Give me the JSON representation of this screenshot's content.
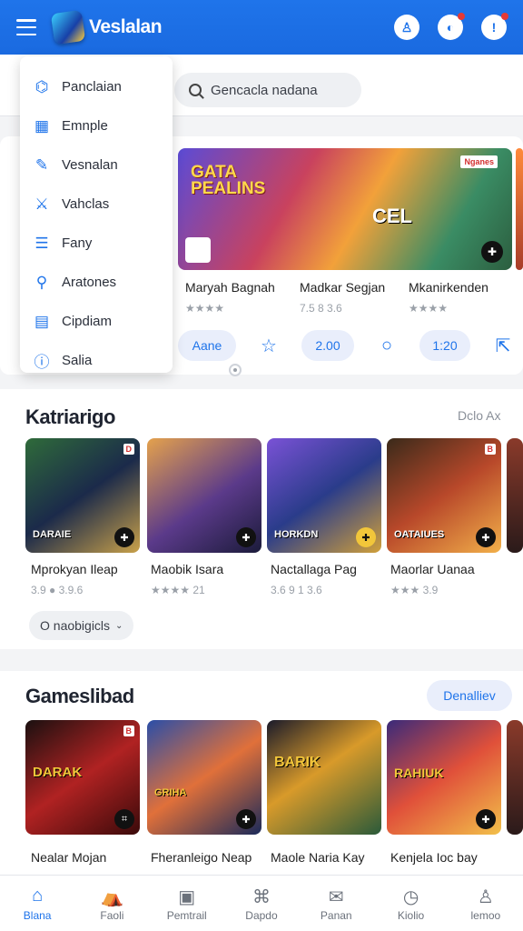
{
  "app": {
    "title": "Veslalan"
  },
  "header": {
    "actions": [
      {
        "icon": "profile-icon",
        "glyph": "♙"
      },
      {
        "icon": "notification-icon",
        "glyph": "◐"
      },
      {
        "icon": "alert-icon",
        "glyph": "!"
      }
    ]
  },
  "search": {
    "placeholder": "Gencacla nadana"
  },
  "drawer": {
    "items": [
      {
        "label": "Panclaian",
        "icon": "compass-icon",
        "glyph": "⌬"
      },
      {
        "label": "Emnple",
        "icon": "grid-icon",
        "glyph": "▦"
      },
      {
        "label": "Vesnalan",
        "icon": "pen-icon",
        "glyph": "✎"
      },
      {
        "label": "Vahclas",
        "icon": "swords-icon",
        "glyph": "⚔"
      },
      {
        "label": "Fany",
        "icon": "list-icon",
        "glyph": "☰"
      },
      {
        "label": "Aratones",
        "icon": "pin-icon",
        "glyph": "⚲"
      },
      {
        "label": "Cipdiam",
        "icon": "calendar-icon",
        "glyph": "▤"
      },
      {
        "label": "Salia",
        "icon": "info-icon",
        "glyph": "ⓘ"
      }
    ]
  },
  "featured": {
    "badge": "Nganes",
    "overlay_line1": "GATA",
    "overlay_line2": "PEALINS",
    "overlay_tag": "CEL",
    "games": [
      {
        "title": "Maryah Bagnah",
        "rating": "★★★★"
      },
      {
        "title": "Madkar Segjan",
        "rating": "7.5 8  3.6"
      },
      {
        "title": "Mkanirkenden",
        "rating": "★★★★"
      }
    ],
    "actions": {
      "primary": "Aane",
      "score1": "2.00",
      "score2": "1:20"
    }
  },
  "section_kategori": {
    "title": "Katriarigo",
    "link": "Dclo Ax",
    "chip": "O naobigicls",
    "games": [
      {
        "title": "Mprokyan Ileap",
        "rating": "3.9  ●  3.9.6",
        "tile_label": "DARAIE",
        "flag": "D"
      },
      {
        "title": "Maobik Isara",
        "rating": "★★★★  21",
        "tile_label": "",
        "flag": ""
      },
      {
        "title": "Nactallaga Pag",
        "rating": "3.6 9  1 3.6",
        "tile_label": "HORKDN",
        "flag": ""
      },
      {
        "title": "Maorlar Uanaa",
        "rating": "★★★  3.9",
        "tile_label": "OATAIUES",
        "flag": "B"
      }
    ]
  },
  "section_games": {
    "title": "Gameslibad",
    "link": "Denalliev",
    "games": [
      {
        "title": "Nealar Mojan",
        "tile_label": "DARAK",
        "flag": "B"
      },
      {
        "title": "Fheranleigo Neap",
        "tile_label": "GRIHA",
        "flag": ""
      },
      {
        "title": "Maole Naria Kay",
        "tile_label": "BARIK",
        "flag": ""
      },
      {
        "title": "Kenjela Ioc bay",
        "tile_label": "RAHIUK",
        "flag": ""
      }
    ]
  },
  "bottom_nav": [
    {
      "label": "Blana",
      "icon": "home-icon",
      "glyph": "⌂",
      "active": true
    },
    {
      "label": "Faoli",
      "icon": "store-icon",
      "glyph": "⛺",
      "active": false
    },
    {
      "label": "Pemtrail",
      "icon": "library-icon",
      "glyph": "▣",
      "active": false
    },
    {
      "label": "Dapdo",
      "icon": "bookmark-icon",
      "glyph": "⌘",
      "active": false
    },
    {
      "label": "Panan",
      "icon": "chat-icon",
      "glyph": "✉",
      "active": false
    },
    {
      "label": "Kiolio",
      "icon": "clock-icon",
      "glyph": "◷",
      "active": false
    },
    {
      "label": "lemoo",
      "icon": "user-icon",
      "glyph": "♙",
      "active": false
    }
  ],
  "colors": {
    "primary": "#1f74ea",
    "accent_red": "#e53935"
  }
}
